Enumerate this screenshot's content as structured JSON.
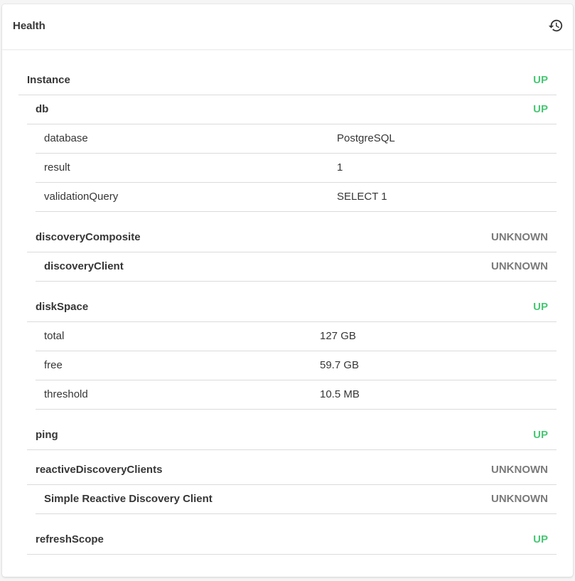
{
  "card": {
    "title": "Health",
    "history_icon": "history-icon"
  },
  "colors": {
    "up": "#48c774",
    "unknown": "#7a7a7a"
  },
  "instance": {
    "label": "Instance",
    "status": "UP"
  },
  "db": {
    "label": "db",
    "status": "UP",
    "details": [
      {
        "key": "database",
        "value": "PostgreSQL"
      },
      {
        "key": "result",
        "value": "1"
      },
      {
        "key": "validationQuery",
        "value": "SELECT 1"
      }
    ]
  },
  "discoveryComposite": {
    "label": "discoveryComposite",
    "status": "UNKNOWN",
    "child": {
      "label": "discoveryClient",
      "status": "UNKNOWN"
    }
  },
  "diskSpace": {
    "label": "diskSpace",
    "status": "UP",
    "details": [
      {
        "key": "total",
        "value": "127 GB"
      },
      {
        "key": "free",
        "value": "59.7 GB"
      },
      {
        "key": "threshold",
        "value": "10.5 MB"
      }
    ]
  },
  "ping": {
    "label": "ping",
    "status": "UP"
  },
  "reactiveDiscoveryClients": {
    "label": "reactiveDiscoveryClients",
    "status": "UNKNOWN",
    "child": {
      "label": "Simple Reactive Discovery Client",
      "status": "UNKNOWN"
    }
  },
  "refreshScope": {
    "label": "refreshScope",
    "status": "UP"
  }
}
